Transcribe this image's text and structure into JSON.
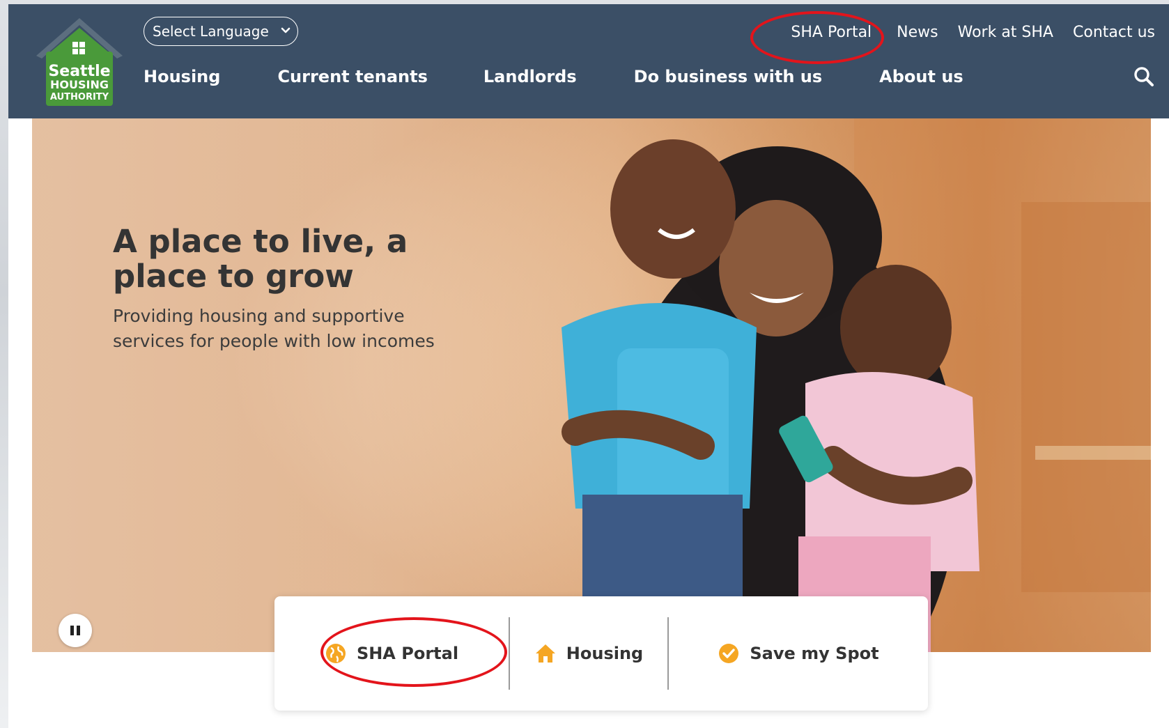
{
  "header": {
    "logo": {
      "line1": "Seattle",
      "line2": "HOUSING",
      "line3": "AUTHORITY"
    },
    "language": {
      "selected": "Select Language",
      "options": [
        "Select Language"
      ]
    },
    "utility_nav": [
      {
        "label": "SHA Portal"
      },
      {
        "label": "News"
      },
      {
        "label": "Work at SHA"
      },
      {
        "label": "Contact us"
      }
    ],
    "main_nav": [
      {
        "label": "Housing"
      },
      {
        "label": "Current tenants"
      },
      {
        "label": "Landlords"
      },
      {
        "label": "Do business with us"
      },
      {
        "label": "About us"
      }
    ],
    "search_icon": "search-icon"
  },
  "hero": {
    "title": "A place to live, a place to grow",
    "subtitle": "Providing housing and supportive services for people with low incomes",
    "pause_icon": "pause-icon"
  },
  "quick_links": [
    {
      "label": "SHA Portal",
      "icon": "globe-icon"
    },
    {
      "label": "Housing",
      "icon": "home-icon"
    },
    {
      "label": "Save my Spot",
      "icon": "check-circle-icon"
    }
  ],
  "colors": {
    "header_bg": "#3b4f66",
    "logo_green": "#4a9a3a",
    "accent_orange": "#f5a623",
    "highlight_red": "#e3141b"
  }
}
